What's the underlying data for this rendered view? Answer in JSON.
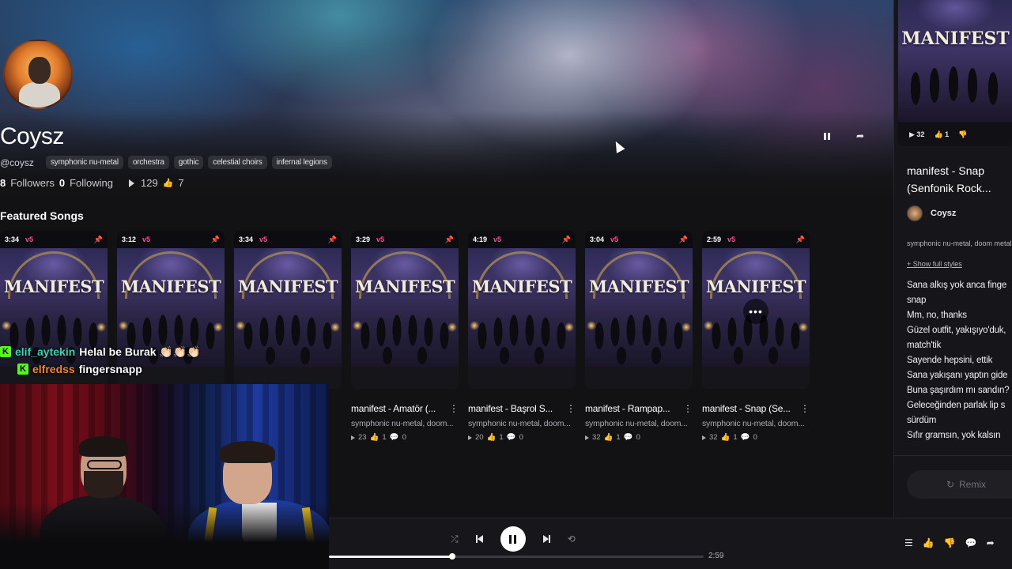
{
  "artist": {
    "name": "Coysz",
    "handle": "@coysz",
    "tags": [
      "symphonic nu-metal",
      "orchestra",
      "gothic",
      "celestial choirs",
      "infernal legions"
    ],
    "followers_count": "8",
    "followers_label": "Followers",
    "following_count": "0",
    "following_label": "Following",
    "plays": "129",
    "likes": "7"
  },
  "section": {
    "featured_title": "Featured Songs"
  },
  "cover_logo_text": "MANIFEST",
  "cards": [
    {
      "duration": "3:34",
      "version": "v5",
      "title": "",
      "styles": "",
      "plays": "",
      "likes": "",
      "comments": ""
    },
    {
      "duration": "3:12",
      "version": "v5",
      "title": "",
      "styles": "",
      "plays": "",
      "likes": "",
      "comments": ""
    },
    {
      "duration": "3:34",
      "version": "v5",
      "title": "",
      "styles": "",
      "plays": "",
      "likes": "",
      "comments": ""
    },
    {
      "duration": "3:29",
      "version": "v5",
      "title": "manifest - Amatör (...",
      "styles": "symphonic nu-metal, doom...",
      "plays": "23",
      "likes": "1",
      "comments": "0"
    },
    {
      "duration": "4:19",
      "version": "v5",
      "title": "manifest - Başrol S...",
      "styles": "symphonic nu-metal, doom...",
      "plays": "20",
      "likes": "1",
      "comments": "0"
    },
    {
      "duration": "3:04",
      "version": "v5",
      "title": "manifest - Rampap...",
      "styles": "symphonic nu-metal, doom...",
      "plays": "32",
      "likes": "1",
      "comments": "0"
    },
    {
      "duration": "2:59",
      "version": "v5",
      "title": "manifest - Snap (Se...",
      "styles": "symphonic nu-metal, doom...",
      "plays": "32",
      "likes": "1",
      "comments": "0"
    }
  ],
  "right_panel": {
    "cover_plays": "32",
    "cover_likes": "1",
    "title": "manifest - Snap (Senfonik Rock...",
    "artist": "Coysz",
    "styles": "symphonic nu-metal, doom metal",
    "show_styles": "+ Show full styles",
    "lyrics": [
      "Sana alkış yok anca finge",
      "snap",
      "Mm, no, thanks",
      "Güzel outfit, yakışıyo'duk,",
      "match'tik",
      "Sayende hepsini, ettik",
      "Sana yakışanı yaptın gide",
      "Buna şaşırdım mı sandın?",
      "Geleceğinden parlak lip s",
      "sürdüm",
      "Sıfır gramsın, yok kalsın"
    ],
    "remix_label": "Remix"
  },
  "player": {
    "total_time": "2:59",
    "progress_fraction": 0.33
  },
  "chat": [
    {
      "user": "elif_aytekin",
      "message": "Helal be Burak 👏🏻👏🏻👏🏻"
    },
    {
      "user": "elfredss",
      "message": "fingersnapp"
    }
  ],
  "colors": {
    "version_badge": "#ff4f8f",
    "kick_badge": "#53fc18"
  }
}
